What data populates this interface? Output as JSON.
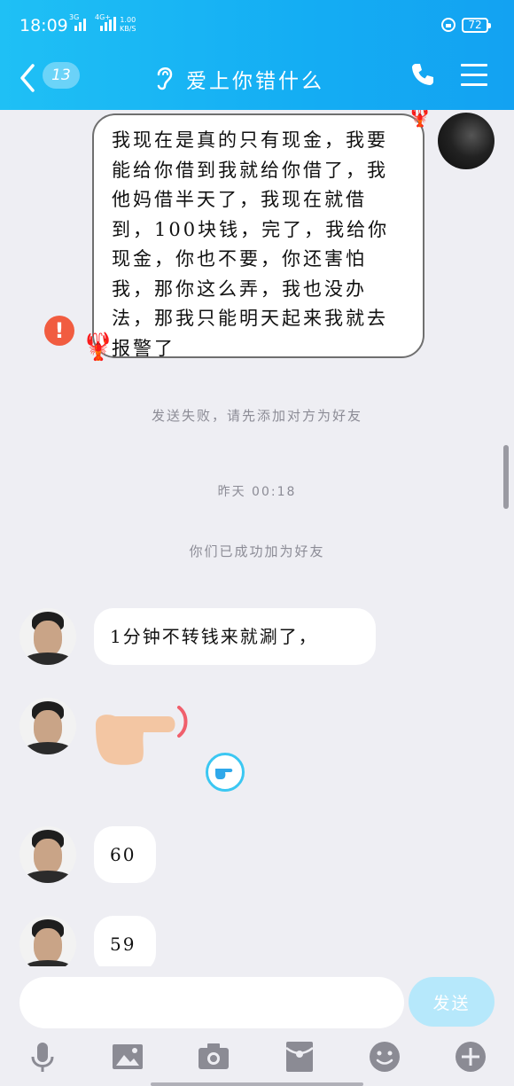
{
  "status_bar": {
    "time": "18:09",
    "signal1_label": "3G",
    "signal2_label": "4G+",
    "net_speed_value": "1.00",
    "net_speed_unit": "KB/S",
    "battery": "72"
  },
  "header": {
    "unread_count": "13",
    "title": "爱上你错什么"
  },
  "messages": {
    "outgoing_text": "我现在是真的只有现金，我要能给你借到我就给你借了，我他妈借半天了，我现在就借到，100块钱，完了，我给你现金，你也不要，你还害怕我，那你这么弄，我也没办法，那我只能明天起来我就去报警了",
    "send_failed_notice": "发送失败，请先添加对方为好友",
    "timestamp": "昨天 00:18",
    "friend_added_notice": "你们已成功加为好友",
    "incoming": [
      {
        "text": "1分钟不转钱来就涮了，"
      },
      {
        "text": "60"
      },
      {
        "text": "59"
      }
    ]
  },
  "input_bar": {
    "placeholder": "",
    "send_label": "发送"
  },
  "icons": {
    "back": "chevron-left-icon",
    "listen": "ear-icon",
    "call": "phone-icon",
    "menu": "menu-icon",
    "error": "error-icon",
    "voice": "microphone-icon",
    "image": "image-icon",
    "camera": "camera-icon",
    "red_packet": "red-packet-icon",
    "emoji": "emoji-icon",
    "more": "plus-icon"
  },
  "colors": {
    "header": "#14adf3",
    "error": "#f15c40",
    "send_button": "#b6e8fb",
    "background": "#eeeef3"
  }
}
